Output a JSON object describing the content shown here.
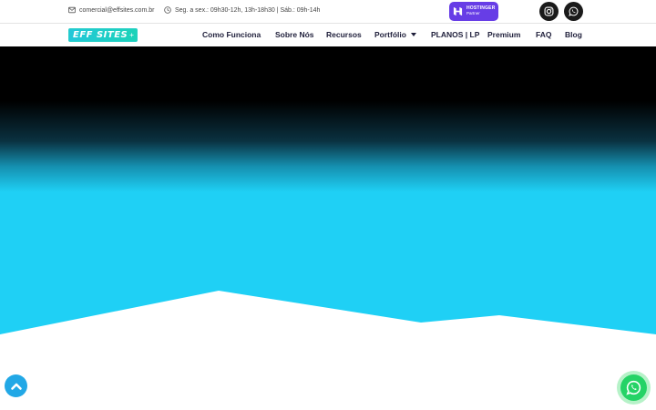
{
  "topbar": {
    "email": "comercial@effsites.com.br",
    "hours": "Seg. a sex.: 09h30-12h, 13h-18h30 | Sáb.: 09h-14h",
    "partner_badge": {
      "name": "HOSTINGER",
      "sub": "Partner"
    },
    "social": [
      "instagram-icon",
      "whatsapp-icon"
    ]
  },
  "nav": {
    "logo": {
      "text": "EFF SITES",
      "plus": "+"
    },
    "items": [
      {
        "label": "Como Funciona"
      },
      {
        "label": "Sobre Nós"
      },
      {
        "label": "Recursos"
      },
      {
        "label": "Portfólio"
      },
      {
        "label": "PLANOS | LP"
      },
      {
        "label": "Premium"
      },
      {
        "label": "FAQ"
      },
      {
        "label": "Blog"
      }
    ]
  },
  "colors": {
    "hero_top": "#000000",
    "hero_bottom": "#1fd0f5",
    "accent_cyan": "#22c7d9",
    "hostinger_purple": "#673de6",
    "whatsapp_green": "#25d366",
    "scroll_button": "#22a8e6"
  },
  "floating": {
    "scroll_top_icon": "chevron-up-icon",
    "whatsapp_icon": "whatsapp-icon"
  }
}
